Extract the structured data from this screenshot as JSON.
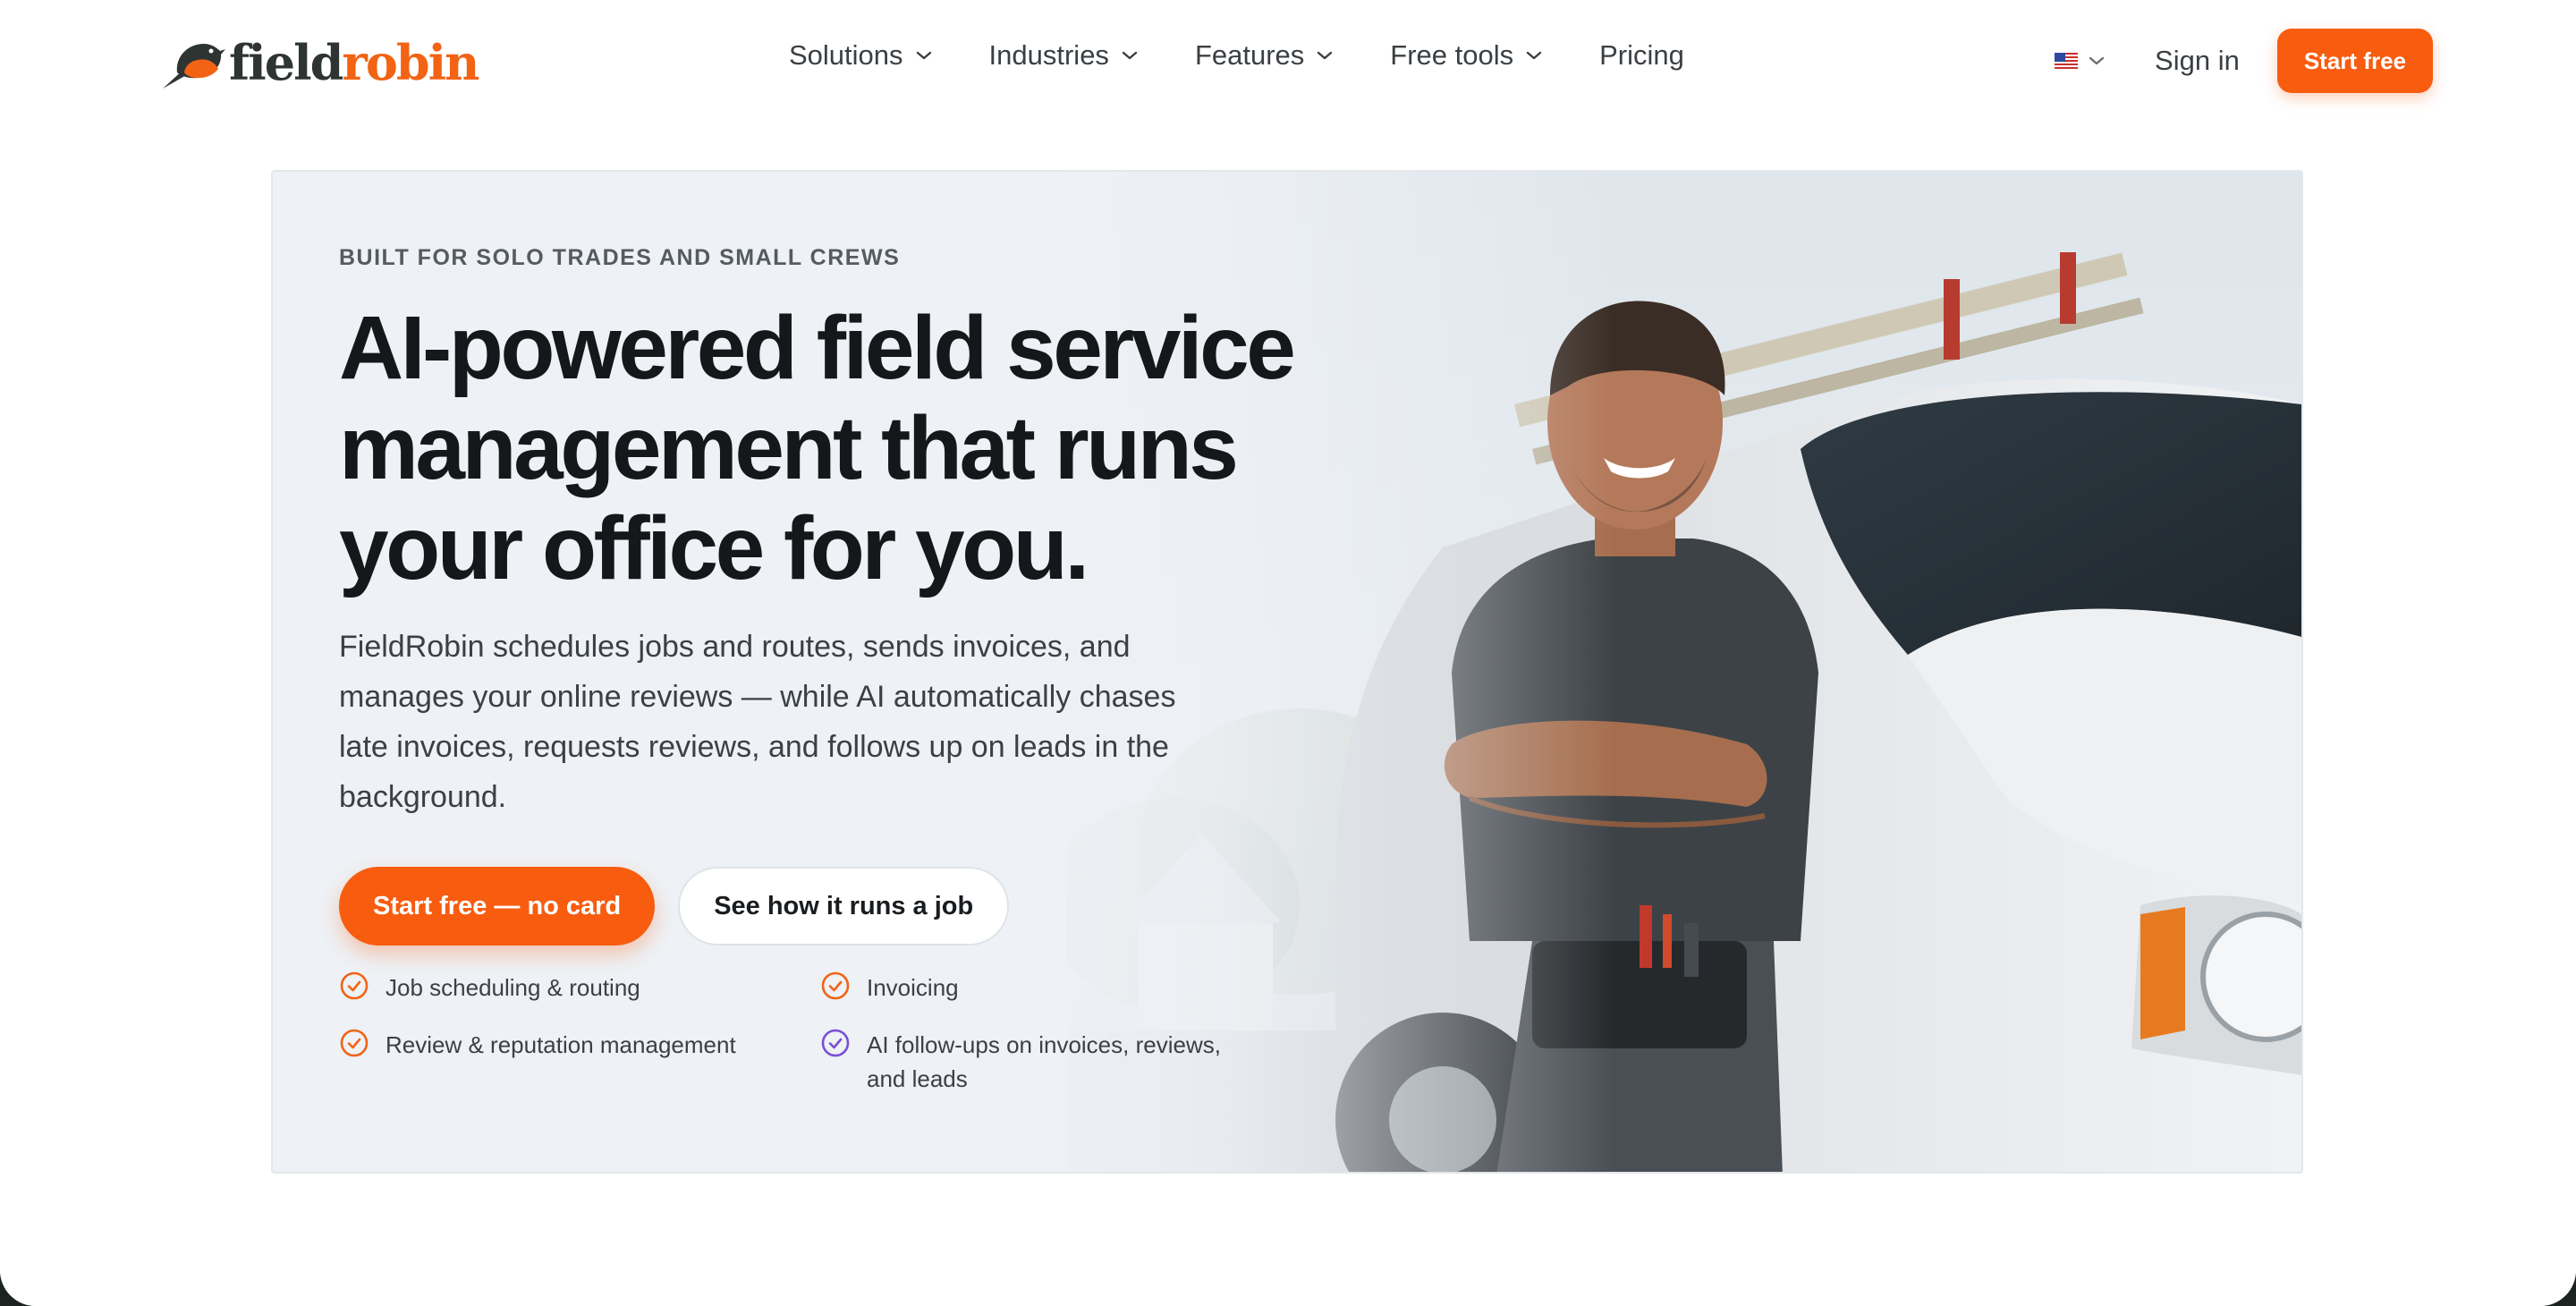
{
  "brand": {
    "part1": "field",
    "part2": "robin"
  },
  "nav": {
    "links": [
      {
        "label": "Solutions",
        "has_dropdown": true
      },
      {
        "label": "Industries",
        "has_dropdown": true
      },
      {
        "label": "Features",
        "has_dropdown": true
      },
      {
        "label": "Free tools",
        "has_dropdown": true
      },
      {
        "label": "Pricing",
        "has_dropdown": false
      }
    ],
    "sign_in": "Sign in",
    "start_free": "Start free",
    "language_flag": "us-flag-icon"
  },
  "hero": {
    "eyebrow": "BUILT FOR SOLO TRADES AND SMALL CREWS",
    "headline_line1": "AI-powered field service",
    "headline_line2": "management that runs",
    "headline_line3": "your office for you.",
    "subcopy": "FieldRobin schedules jobs and routes, sends invoices, and manages your online reviews — while AI automatically chases late invoices, requests reviews, and follows up on leads in the background.",
    "cta_primary": "Start free — no card",
    "cta_secondary": "See how it runs a job",
    "features": [
      {
        "label": "Job scheduling & routing",
        "color": "#f26314"
      },
      {
        "label": "Invoicing",
        "color": "#f26314"
      },
      {
        "label": "Review & reputation management",
        "color": "#f26314"
      },
      {
        "label": "AI follow-ups on invoices, reviews, and leads",
        "color": "#7a4fd6"
      }
    ]
  },
  "colors": {
    "accent": "#f75c0f",
    "ai_accent": "#7a4fd6",
    "text_dark": "#15181b"
  }
}
